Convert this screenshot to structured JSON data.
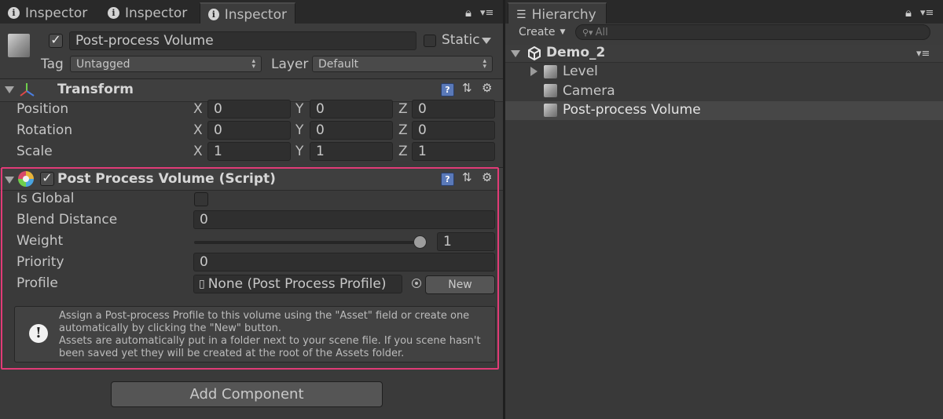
{
  "inspector": {
    "tabs": [
      {
        "label": "Inspector"
      },
      {
        "label": "Inspector"
      },
      {
        "label": "Inspector"
      }
    ],
    "object": {
      "name": "Post-process Volume",
      "static_label": "Static",
      "tag_label": "Tag",
      "tag_value": "Untagged",
      "layer_label": "Layer",
      "layer_value": "Default"
    },
    "transform": {
      "title": "Transform",
      "rows": [
        {
          "label": "Position",
          "x": "0",
          "y": "0",
          "z": "0"
        },
        {
          "label": "Rotation",
          "x": "0",
          "y": "0",
          "z": "0"
        },
        {
          "label": "Scale",
          "x": "1",
          "y": "1",
          "z": "1"
        }
      ],
      "axes": {
        "x": "X",
        "y": "Y",
        "z": "Z"
      }
    },
    "volume": {
      "title": "Post Process Volume (Script)",
      "is_global_label": "Is Global",
      "is_global": false,
      "blend_label": "Blend Distance",
      "blend_value": "0",
      "weight_label": "Weight",
      "weight_value": "1",
      "weight_fraction": 1.0,
      "priority_label": "Priority",
      "priority_value": "0",
      "profile_label": "Profile",
      "profile_value": "None (Post Process Profile)",
      "new_button": "New",
      "help_lines": [
        "Assign a Post-process Profile to this volume using the \"Asset\" field or create one",
        "automatically by clicking the \"New\" button.",
        "Assets are automatically put in a folder next to your scene file. If you scene hasn't",
        "been saved yet they will be created at the root of the Assets folder."
      ]
    },
    "add_component": "Add Component"
  },
  "hierarchy": {
    "tab_label": "Hierarchy",
    "create_label": "Create",
    "search_placeholder": "All",
    "scene": "Demo_2",
    "items": [
      {
        "label": "Level"
      },
      {
        "label": "Camera"
      },
      {
        "label": "Post-process Volume"
      }
    ],
    "selected_item": "Post-process Volume"
  },
  "icons": {
    "info": "info-icon",
    "lock": "lock-icon",
    "menu": "panel-menu-icon",
    "gear": "gear-icon",
    "help": "help-icon",
    "preset": "preset-icon",
    "unity": "unity-logo-icon",
    "cube": "gameobject-icon",
    "warning": "info-circle-icon"
  },
  "colors": {
    "highlight_border": "#e13b77",
    "background": "#383838",
    "selected_row": "#474747"
  }
}
